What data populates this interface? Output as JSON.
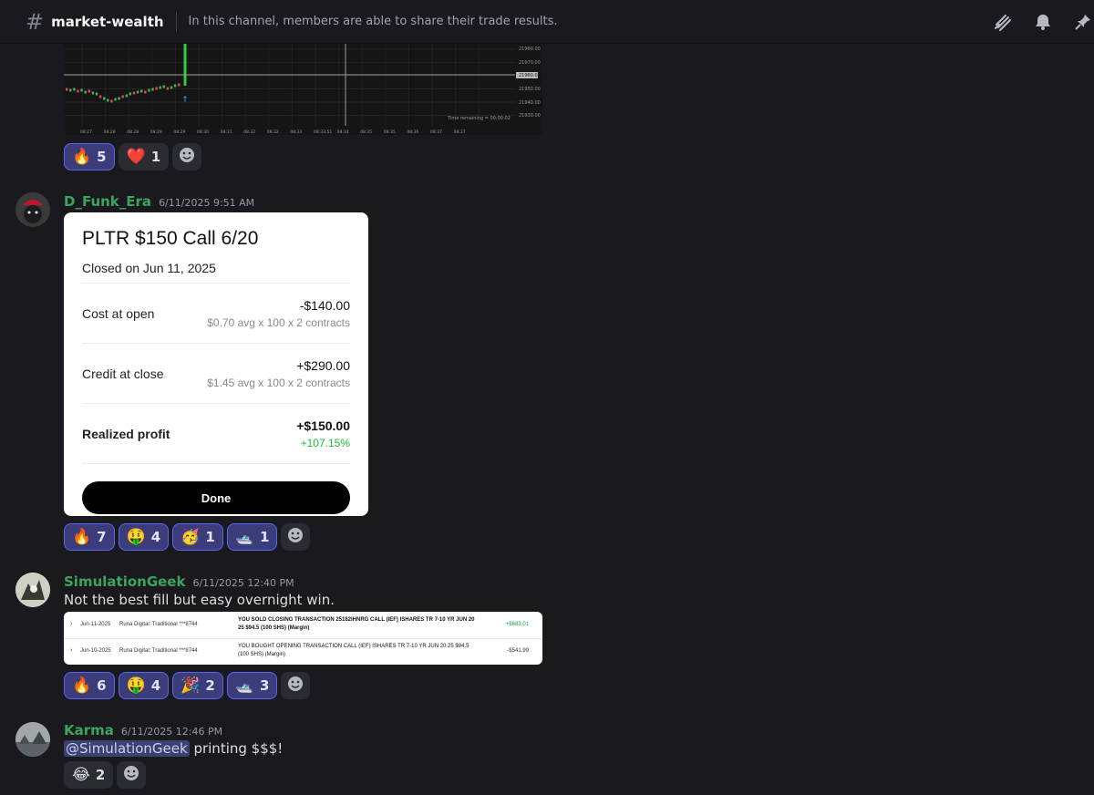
{
  "header": {
    "channel_name": "market-wealth",
    "topic": "In this channel, members are able to share their trade results.",
    "icons": [
      "threads-icon",
      "bell-icon",
      "pin-icon"
    ]
  },
  "chart": {
    "price_labels": [
      "21960.00",
      "21970.00",
      "21960.00",
      "21950.00",
      "21940.00",
      "21930.00"
    ],
    "time_labels": [
      "08:27",
      "08:28",
      "08:28",
      "08:29",
      "08:29",
      "08:30",
      "08:31",
      "08:32",
      "08:32",
      "08:33",
      "08:33:51",
      "08:34",
      "08:35",
      "08:35",
      "08:36",
      "08:37",
      "08:37"
    ],
    "time_remaining": "Time remaining = 00:00:02",
    "reactions": [
      {
        "emoji": "🔥",
        "count": "5",
        "me": true
      },
      {
        "emoji": "❤️",
        "count": "1",
        "me": false
      }
    ]
  },
  "messages": [
    {
      "username": "D_Funk_Era",
      "timestamp": "6/11/2025 9:51 AM",
      "card": {
        "title": "PLTR $150 Call 6/20",
        "subtitle": "Closed on Jun 11, 2025",
        "rows": [
          {
            "label": "Cost at open",
            "value": "-$140.00",
            "sub": "$0.70 avg x 100 x 2 contracts"
          },
          {
            "label": "Credit at close",
            "value": "+$290.00",
            "sub": "$1.45 avg x 100 x 2 contracts"
          },
          {
            "label": "Realized profit",
            "value": "+$150.00",
            "sub": "+107.15%"
          }
        ],
        "button": "Done",
        "accent_green": "#1fbf3a"
      },
      "reactions": [
        {
          "emoji": "🔥",
          "count": "7"
        },
        {
          "emoji": "🤑",
          "count": "4"
        },
        {
          "emoji": "🥳",
          "count": "1"
        },
        {
          "emoji": "🛥️",
          "count": "1"
        }
      ]
    },
    {
      "username": "SimulationGeek",
      "timestamp": "6/11/2025 12:40 PM",
      "text": "Not the best fill but easy overnight win.",
      "transactions": [
        {
          "date": "Jun-11-2025",
          "account": "Runa Digital: Traditional ***8744",
          "desc": "YOU SOLD CLOSING TRANSACTION 25162IHNRG CALL (IEF) ISHARES TR 7-10 YR JUN 20 25 $94.5 (100 SHS) (Margin)",
          "amount": "+$683.01",
          "positive": true
        },
        {
          "date": "Jun-10-2025",
          "account": "Runa Digital: Traditional ***8744",
          "desc": "YOU BOUGHT OPENING TRANSACTION CALL (IEF) ISHARES TR 7-10 YR JUN 20 25 $94.5 (100 SHS) (Margin)",
          "amount": "-$541.99",
          "positive": false
        }
      ],
      "reactions": [
        {
          "emoji": "🔥",
          "count": "6"
        },
        {
          "emoji": "🤑",
          "count": "4"
        },
        {
          "emoji": "🎉",
          "count": "2"
        },
        {
          "emoji": "🛥️",
          "count": "3"
        }
      ]
    },
    {
      "username": "Karma",
      "timestamp": "6/11/2025 12:46 PM",
      "mention": "@SimulationGeek",
      "text": "printing $$$!",
      "reactions": [
        {
          "emoji": "😂",
          "count": "2"
        }
      ]
    }
  ],
  "colors": {
    "background": "#1a1a1e",
    "username_green": "#3ba55d",
    "reaction_me": "#5865f2"
  }
}
